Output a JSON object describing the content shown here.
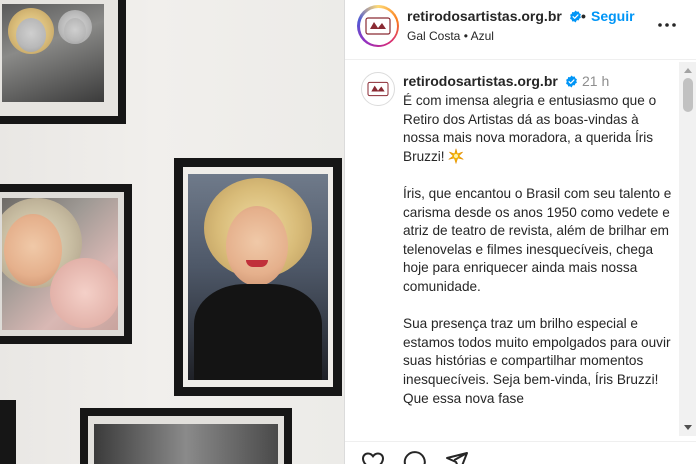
{
  "header": {
    "username": "retirodosartistas.org.br",
    "separator": "•",
    "follow_label": "Seguir",
    "subtitle": "Gal Costa • Azul"
  },
  "caption": {
    "username": "retirodosartistas.org.br",
    "time": "21 h",
    "paragraphs": [
      "É com imensa alegria e entusiasmo que o Retiro dos Artistas dá as boas-vindas à nossa mais nova moradora, a querida Íris Bruzzi!",
      "Íris, que encantou o Brasil com seu talento e carisma desde os anos 1950 como vedete e atriz de teatro de revista, além de brilhar em telenovelas e filmes inesquecíveis, chega hoje para enriquecer ainda mais nossa comunidade.",
      "Sua presença traz um brilho especial e estamos todos muito empolgados para ouvir suas histórias e compartilhar momentos inesquecíveis. Seja bem-vinda, Íris Bruzzi! Que essa nova fase"
    ]
  },
  "icons": {
    "verified": "verified-badge-icon",
    "more": "more-options-icon",
    "sparkle": "sparkle-emoji-icon",
    "like": "heart-icon",
    "comment": "comment-icon",
    "share": "share-icon"
  },
  "colors": {
    "link": "#0095f6",
    "verified": "#0095f6",
    "text": "#262626",
    "muted": "#8e8e8e"
  }
}
